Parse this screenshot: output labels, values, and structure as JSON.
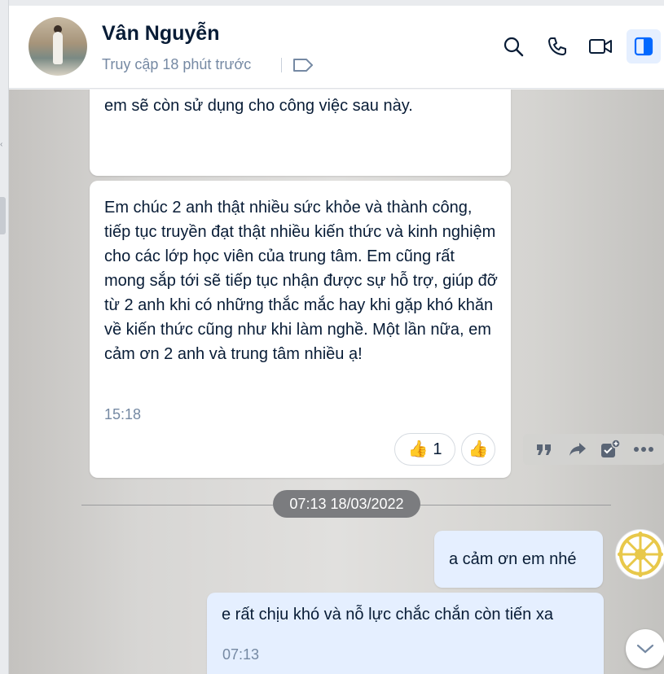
{
  "header": {
    "contact_name": "Vân Nguyễn",
    "status": "Truy cập 18 phút trước",
    "icons": [
      "tag-icon",
      "search-icon",
      "phone-icon",
      "video-call-icon",
      "sidebar-toggle-icon"
    ]
  },
  "messages": {
    "m1_text": "chúng em thật sự rất hay và bổ ích, chắc chắn chúng em sẽ còn sử dụng cho công việc sau này.",
    "m2_text": "Em chúc 2 anh thật nhiều sức khỏe và thành công, tiếp tục truyền đạt thật nhiều kiến thức và kinh nghiệm cho các lớp học viên của trung tâm. Em cũng rất mong sắp tới sẽ tiếp tục nhận được sự hỗ trợ, giúp đỡ từ 2 anh khi có những thắc mắc hay khi gặp khó khăn về kiến thức cũng như khi làm nghề. Một lần nữa, em cảm ơn 2 anh và trung tâm nhiều ạ!",
    "m2_time": "15:18",
    "reaction_count": "1",
    "reaction_emoji": "👍",
    "date_divider": "07:13 18/03/2022",
    "my1_text": "a cảm ơn em nhé",
    "my2_text": "e rất chịu khó và nỗ lực chắc chắn còn tiến xa",
    "my2_time": "07:13"
  },
  "colors": {
    "accent": "#0068ff",
    "text": "#081c36",
    "muted": "#7589a3",
    "my_bubble": "#e5efff"
  }
}
